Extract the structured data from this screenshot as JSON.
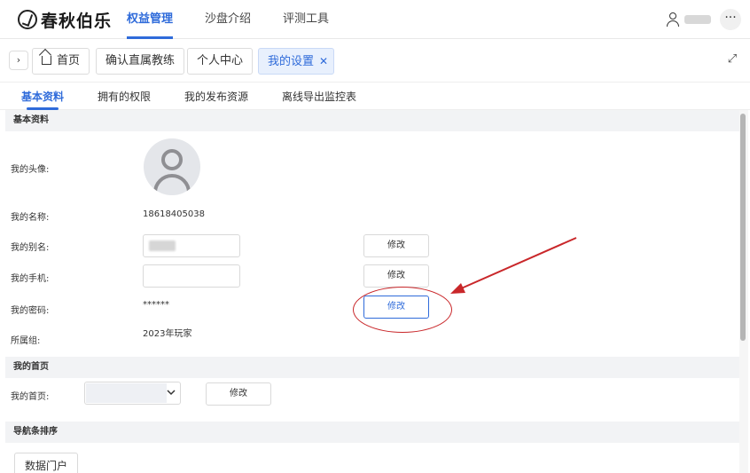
{
  "header": {
    "logo_text": "春秋伯乐",
    "nav": [
      {
        "label": "权益管理",
        "active": true
      },
      {
        "label": "沙盘介绍",
        "active": false
      },
      {
        "label": "评测工具",
        "active": false
      }
    ],
    "more_label": "···"
  },
  "tabbar": {
    "toggle_glyph": "›",
    "tabs": [
      {
        "label": "首页",
        "active": false
      },
      {
        "label": "确认直属教练",
        "active": false
      },
      {
        "label": "个人中心",
        "active": false
      },
      {
        "label": "我的设置",
        "active": true
      }
    ],
    "close_glyph": "✕",
    "expand_glyph": "⤢"
  },
  "subtabs": [
    {
      "label": "基本资料",
      "active": true
    },
    {
      "label": "拥有的权限",
      "active": false
    },
    {
      "label": "我的发布资源",
      "active": false
    },
    {
      "label": "离线导出监控表",
      "active": false
    }
  ],
  "basic": {
    "section_title": "基本资料",
    "avatar_label": "我的头像:",
    "name_label": "我的名称:",
    "name_value": "18618405038",
    "alias_label": "我的别名:",
    "alias_value": "",
    "phone_label": "我的手机:",
    "phone_value": "",
    "password_label": "我的密码:",
    "password_value": "******",
    "group_label": "所属组:",
    "group_value": "2023年玩家",
    "modify_label": "修改"
  },
  "homepage": {
    "section_title": "我的首页",
    "label": "我的首页:",
    "selected_value": "",
    "modify_label": "修改"
  },
  "nav_sort": {
    "section_title": "导航条排序",
    "item_label": "数据门户"
  },
  "colors": {
    "accent": "#2f6bda",
    "annotation_red": "#c9272a"
  }
}
